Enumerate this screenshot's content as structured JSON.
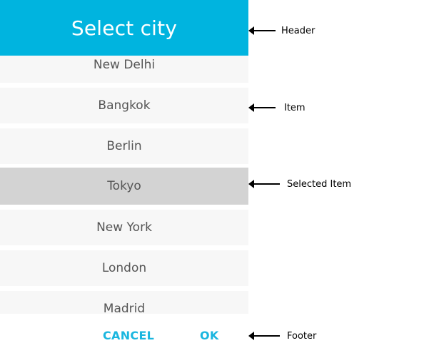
{
  "dialog": {
    "title": "Select city",
    "items": [
      {
        "label": "New Delhi",
        "selected": false
      },
      {
        "label": "Bangkok",
        "selected": false
      },
      {
        "label": "Berlin",
        "selected": false
      },
      {
        "label": "Tokyo",
        "selected": true
      },
      {
        "label": "New York",
        "selected": false
      },
      {
        "label": "London",
        "selected": false
      },
      {
        "label": "Madrid",
        "selected": false
      }
    ],
    "footer": {
      "cancel_label": "CANCEL",
      "ok_label": "OK"
    }
  },
  "annotations": {
    "header": "Header",
    "item": "Item",
    "selected_item": "Selected Item",
    "footer": "Footer"
  },
  "colors": {
    "header_bg": "#00b4df",
    "button_text": "#1ab6df",
    "item_bg": "#f7f7f7",
    "selected_bg": "#d3d3d3"
  }
}
